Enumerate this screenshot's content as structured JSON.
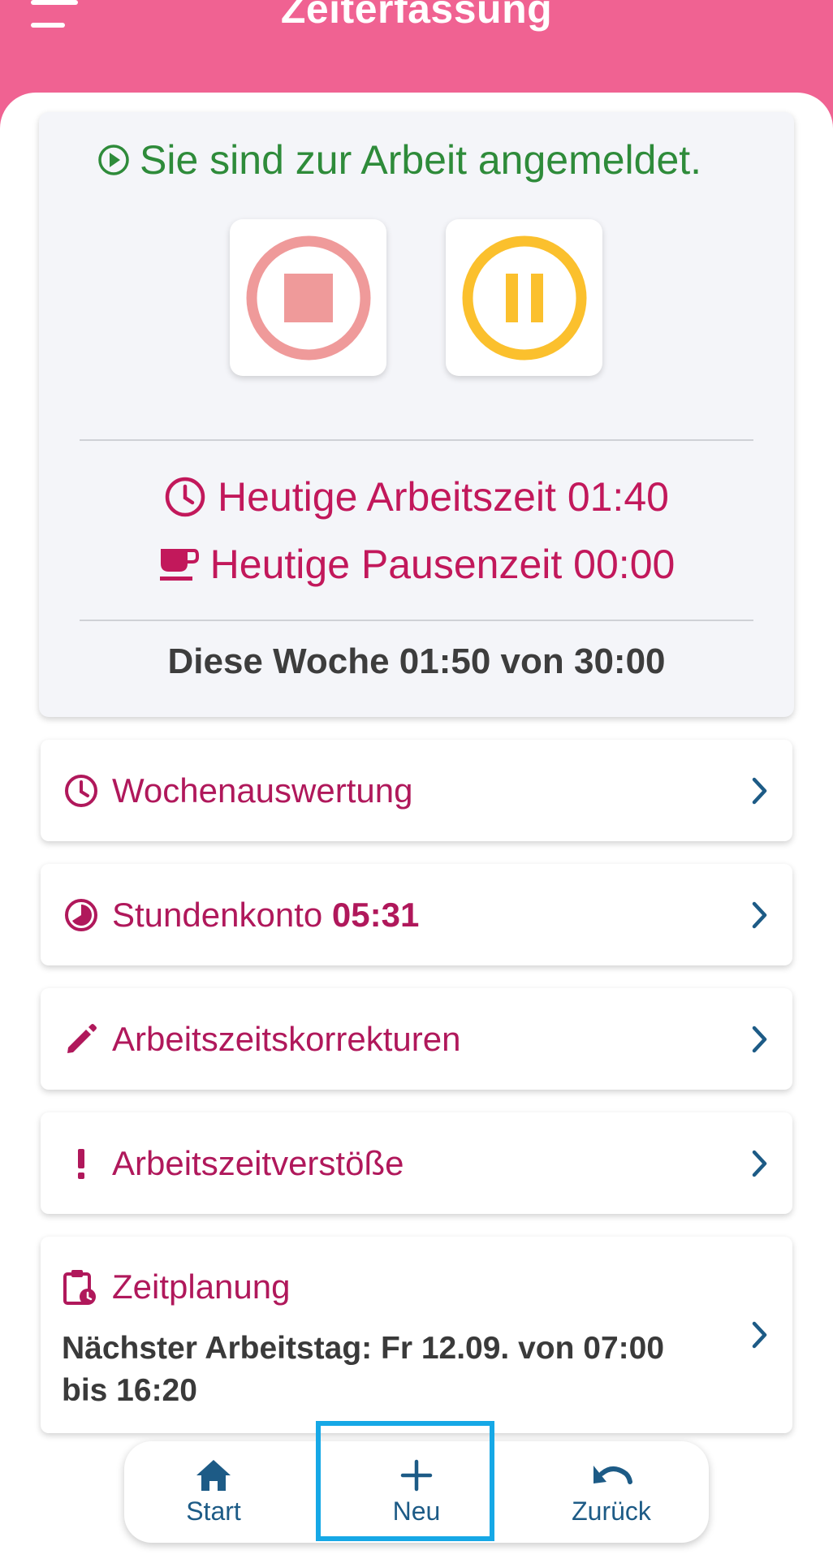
{
  "header": {
    "title": "Zeiterfassung",
    "color": "#f06292"
  },
  "status": {
    "message": "Sie sind zur Arbeit angemeldet.",
    "stop_icon": "stop-circle-icon",
    "pause_icon": "pause-circle-icon",
    "today_work_label": "Heutige Arbeitszeit 01:40",
    "today_break_label": "Heutige Pausenzeit 00:00",
    "week_summary": "Diese Woche 01:50 von 30:00",
    "status_color": "#2e8b3a",
    "accent_color": "#c2185b"
  },
  "menu": {
    "items": [
      {
        "label": "Wochenauswertung",
        "value": "",
        "icon": "clock-icon"
      },
      {
        "label": "Stundenkonto",
        "value": "05:31",
        "icon": "pie-clock-icon"
      },
      {
        "label": "Arbeitszeitskorrekturen",
        "value": "",
        "icon": "pencil-icon"
      },
      {
        "label": "Arbeitszeitverstöße",
        "value": "",
        "icon": "exclamation-icon"
      }
    ]
  },
  "planning": {
    "title": "Zeitplanung",
    "text": "Nächster Arbeitstag: Fr 12.09. von 07:00 bis 16:20",
    "icon": "calendar-clock-icon"
  },
  "bottom_nav": {
    "items": [
      {
        "label": "Start",
        "icon": "home-icon"
      },
      {
        "label": "Neu",
        "icon": "plus-icon"
      },
      {
        "label": "Zurück",
        "icon": "undo-icon"
      }
    ],
    "highlight_color": "#16a8e6"
  }
}
